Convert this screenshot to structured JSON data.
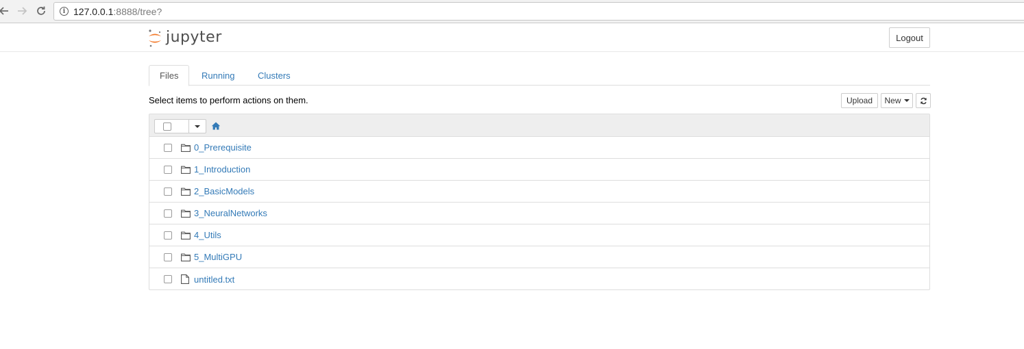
{
  "browser": {
    "url_host": "127.0.0.1",
    "url_path": ":8888/tree?"
  },
  "header": {
    "logo_text": "jupyter",
    "logout_label": "Logout"
  },
  "tabs": [
    {
      "label": "Files",
      "active": true
    },
    {
      "label": "Running",
      "active": false
    },
    {
      "label": "Clusters",
      "active": false
    }
  ],
  "toolbar": {
    "hint": "Select items to perform actions on them.",
    "upload_label": "Upload",
    "new_label": "New",
    "refresh_icon": "refresh-icon"
  },
  "files": [
    {
      "name": "0_Prerequisite",
      "type": "folder"
    },
    {
      "name": "1_Introduction",
      "type": "folder"
    },
    {
      "name": "2_BasicModels",
      "type": "folder"
    },
    {
      "name": "3_NeuralNetworks",
      "type": "folder"
    },
    {
      "name": "4_Utils",
      "type": "folder"
    },
    {
      "name": "5_MultiGPU",
      "type": "folder"
    },
    {
      "name": "untitled.txt",
      "type": "file"
    }
  ],
  "colors": {
    "link": "#337ab7",
    "logo_orange": "#f37726"
  }
}
